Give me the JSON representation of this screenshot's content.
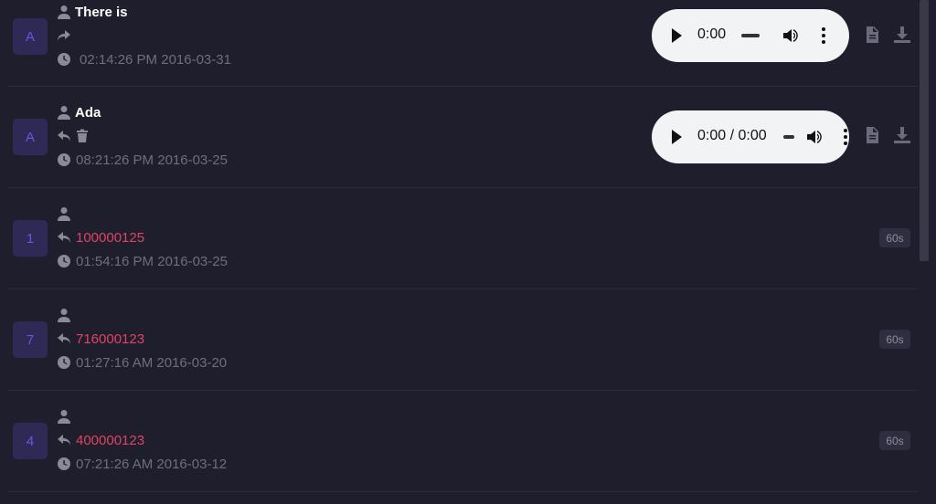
{
  "calls": [
    {
      "avatar": "A",
      "name": "There is",
      "direction": "outgoing",
      "time": "02:14:26 PM 2016-03-31",
      "audio_time": "0:00"
    },
    {
      "avatar": "A",
      "name": "Ada",
      "direction": "incoming",
      "time": "08:21:26 PM 2016-03-25",
      "audio_time": "0:00 / 0:00"
    },
    {
      "avatar": "1",
      "number": "100000125",
      "direction": "incoming",
      "time": "01:54:16 PM 2016-03-25",
      "duration": "60s"
    },
    {
      "avatar": "7",
      "number": "716000123",
      "direction": "incoming",
      "time": "01:27:16 AM 2016-03-20",
      "duration": "60s"
    },
    {
      "avatar": "4",
      "number": "400000123",
      "direction": "incoming",
      "time": "07:21:26 AM 2016-03-12",
      "duration": "60s"
    }
  ],
  "colors": {
    "background": "#1f1e2d",
    "avatar_bg": "#2e2a55",
    "phone": "#e04462",
    "badge_bg": "#2f2e40"
  }
}
